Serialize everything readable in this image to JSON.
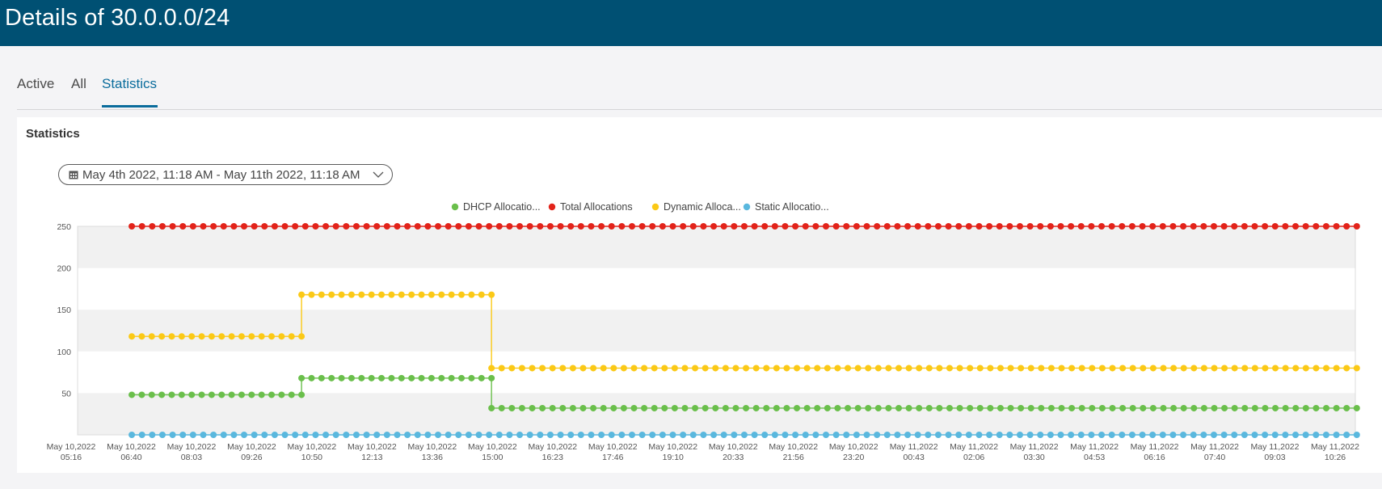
{
  "header": {
    "title": "Details of 30.0.0.0/24"
  },
  "tabs": [
    {
      "label": "Active",
      "active": false
    },
    {
      "label": "All",
      "active": false
    },
    {
      "label": "Statistics",
      "active": true
    }
  ],
  "panel": {
    "title": "Statistics",
    "date_range": "May 4th 2022, 11:18 AM - May 11th 2022, 11:18 AM"
  },
  "colors": {
    "header": "#005073",
    "accent": "#0a6c9c",
    "dhcp": "#6abf4b",
    "total": "#e2231a",
    "dynamic": "#fbc916",
    "static": "#5ab8de"
  },
  "chart_data": {
    "type": "line",
    "legend": [
      {
        "name": "DHCP Allocatio...",
        "color": "#6abf4b"
      },
      {
        "name": "Total Allocations",
        "color": "#e2231a"
      },
      {
        "name": "Dynamic Alloca...",
        "color": "#fbc916"
      },
      {
        "name": "Static Allocatio...",
        "color": "#5ab8de"
      }
    ],
    "legend_position": "top-center",
    "y_ticks": [
      250,
      200,
      150,
      100,
      50
    ],
    "ylim": [
      0,
      250
    ],
    "x_ticks": [
      [
        "May 10,2022",
        "05:16"
      ],
      [
        "May 10,2022",
        "06:40"
      ],
      [
        "May 10,2022",
        "08:03"
      ],
      [
        "May 10,2022",
        "09:26"
      ],
      [
        "May 10,2022",
        "10:50"
      ],
      [
        "May 10,2022",
        "12:13"
      ],
      [
        "May 10,2022",
        "13:36"
      ],
      [
        "May 10,2022",
        "15:00"
      ],
      [
        "May 10,2022",
        "16:23"
      ],
      [
        "May 10,2022",
        "17:46"
      ],
      [
        "May 10,2022",
        "19:10"
      ],
      [
        "May 10,2022",
        "20:33"
      ],
      [
        "May 10,2022",
        "21:56"
      ],
      [
        "May 10,2022",
        "23:20"
      ],
      [
        "May 11,2022",
        "00:43"
      ],
      [
        "May 11,2022",
        "02:06"
      ],
      [
        "May 11,2022",
        "03:30"
      ],
      [
        "May 11,2022",
        "04:53"
      ],
      [
        "May 11,2022",
        "06:16"
      ],
      [
        "May 11,2022",
        "07:40"
      ],
      [
        "May 11,2022",
        "09:03"
      ],
      [
        "May 11,2022",
        "10:26"
      ]
    ],
    "grid": "alternating horizontal bands",
    "series": [
      {
        "name": "Total Allocations",
        "segments": [
          {
            "from": "May 10,2022 06:40",
            "to": "May 11,2022 10:56",
            "value": 250
          }
        ]
      },
      {
        "name": "Dynamic Allocations",
        "segments": [
          {
            "from": "May 10,2022 06:40",
            "to": "May 10,2022 10:35",
            "value": 118
          },
          {
            "from": "May 10,2022 10:35",
            "to": "May 10,2022 14:58",
            "value": 168
          },
          {
            "from": "May 10,2022 14:58",
            "to": "May 11,2022 10:56",
            "value": 80
          }
        ]
      },
      {
        "name": "DHCP Allocations",
        "segments": [
          {
            "from": "May 10,2022 06:40",
            "to": "May 10,2022 10:35",
            "value": 48
          },
          {
            "from": "May 10,2022 10:35",
            "to": "May 10,2022 14:58",
            "value": 68
          },
          {
            "from": "May 10,2022 14:58",
            "to": "May 11,2022 10:56",
            "value": 32
          }
        ]
      },
      {
        "name": "Static Allocations",
        "segments": [
          {
            "from": "May 10,2022 06:40",
            "to": "May 11,2022 10:56",
            "value": 0
          }
        ]
      }
    ]
  }
}
